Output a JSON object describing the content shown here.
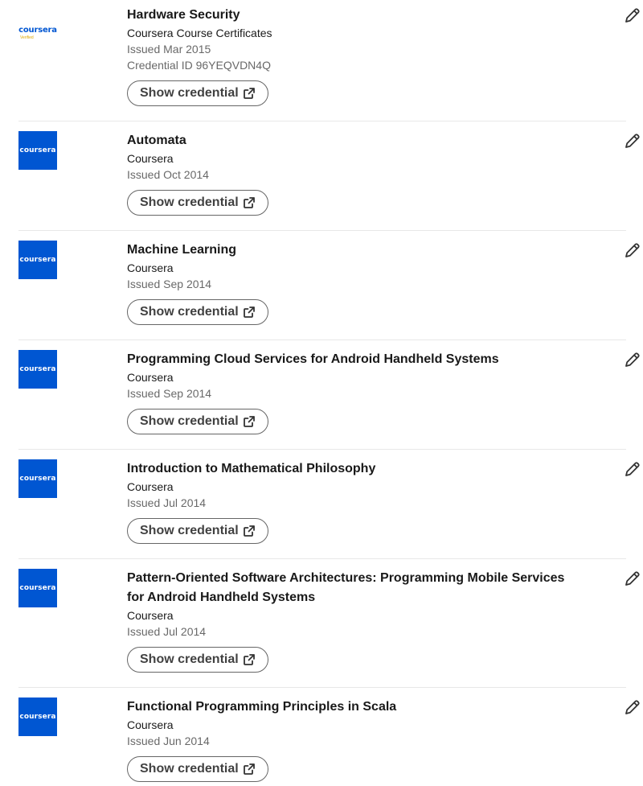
{
  "button_label": "Show credential",
  "brand_color": "#0056d2",
  "logo_text": "coursera",
  "logo_verified_text": "Verified",
  "certificates": [
    {
      "title": "Hardware Security",
      "issuer": "Coursera Course Certificates",
      "issued": "Issued Mar 2015",
      "credential_id": "Credential ID 96YEQVDN4Q"
    },
    {
      "title": "Automata",
      "issuer": "Coursera",
      "issued": "Issued Oct 2014"
    },
    {
      "title": "Machine Learning",
      "issuer": "Coursera",
      "issued": "Issued Sep 2014"
    },
    {
      "title": "Programming Cloud Services for Android Handheld Systems",
      "issuer": "Coursera",
      "issued": "Issued Sep 2014"
    },
    {
      "title": "Introduction to Mathematical Philosophy",
      "issuer": "Coursera",
      "issued": "Issued Jul 2014"
    },
    {
      "title": "Pattern-Oriented Software Architectures: Programming Mobile Services for Android Handheld Systems",
      "issuer": "Coursera",
      "issued": "Issued Jul 2014"
    },
    {
      "title": "Functional Programming Principles in Scala",
      "issuer": "Coursera",
      "issued": "Issued Jun 2014"
    }
  ]
}
